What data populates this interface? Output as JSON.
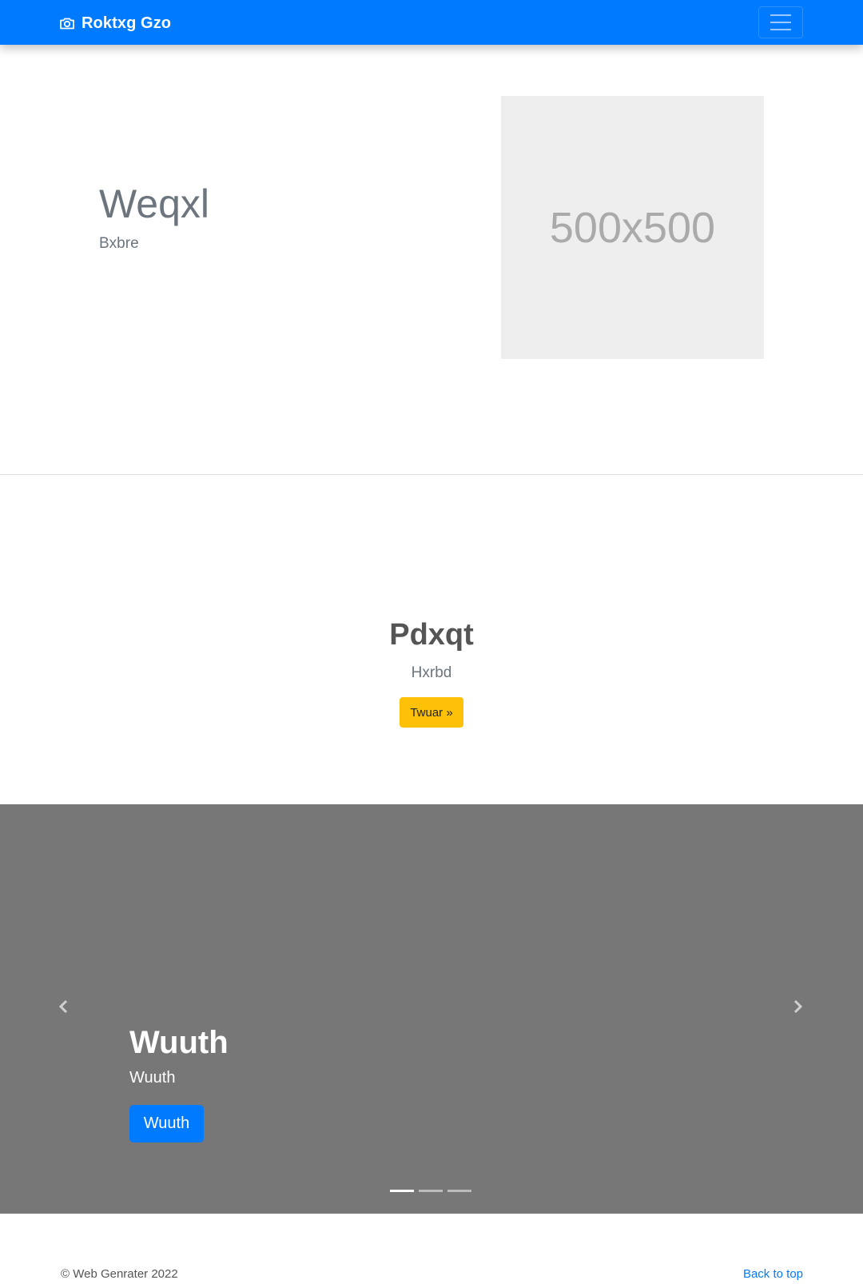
{
  "navbar": {
    "brand_icon": "camera-icon",
    "brand": "Roktxg Gzo",
    "toggler_icon": "hamburger-menu-icon",
    "color": "#007bff"
  },
  "hero": {
    "title": "Weqxl",
    "subtitle": "Bxbre",
    "image_placeholder": "500x500"
  },
  "cta": {
    "title": "Pdxqt",
    "subtitle": "Hxrbd",
    "button_label": "Twuar »",
    "button_color": "#ffc107"
  },
  "carousel": {
    "background": "#777777",
    "prev_icon": "chevron-left-icon",
    "next_icon": "chevron-right-icon",
    "slide": {
      "title": "Wuuth",
      "subtitle": "Wuuth",
      "button_label": "Wuuth"
    },
    "indicator_count": 3,
    "active_indicator": 1
  },
  "footer": {
    "copyright": "© Web Genrater 2022",
    "back_to_top": "Back to top"
  }
}
